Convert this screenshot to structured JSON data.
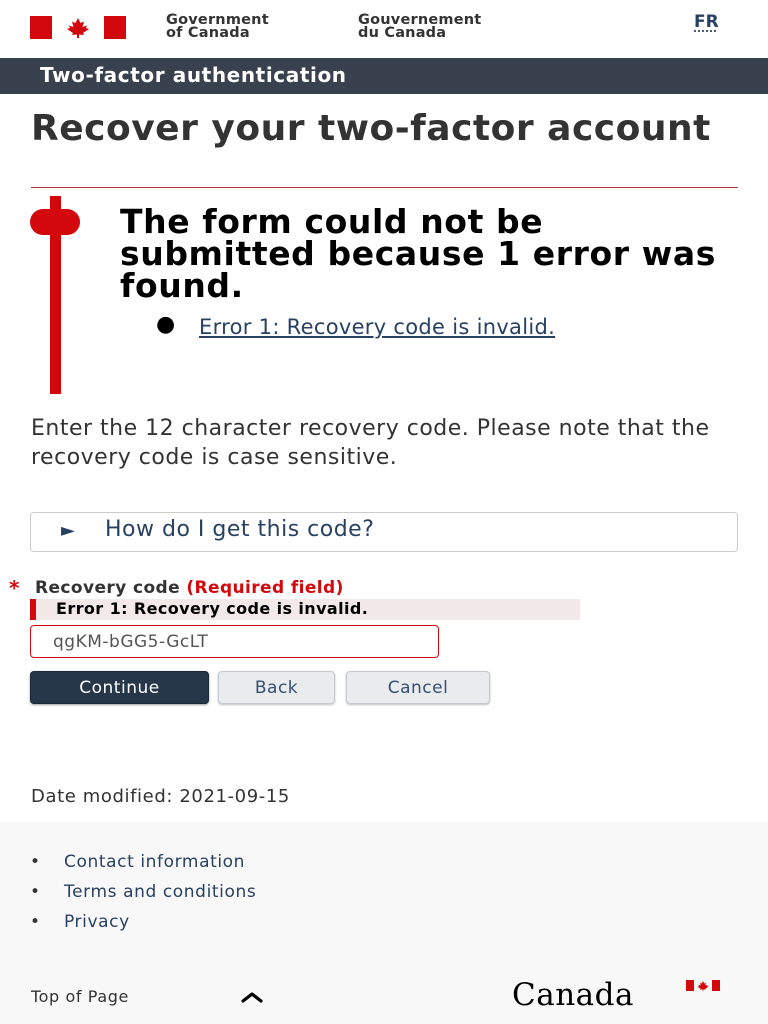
{
  "header": {
    "gov_en_line1": "Government",
    "gov_en_line2": "of Canada",
    "gov_fr_line1": "Gouvernement",
    "gov_fr_line2": "du Canada",
    "language_toggle": "FR",
    "flag_icon": "canada-flag-icon",
    "brand_red": "#d3080c"
  },
  "app_bar": {
    "title": "Two-factor authentication",
    "background": "#38414d"
  },
  "page": {
    "title": "Recover your two-factor account"
  },
  "error_summary": {
    "heading": "The form could not be submitted because 1 error was found.",
    "items": [
      {
        "text": "Error 1: Recovery code is invalid."
      }
    ]
  },
  "instructions": "Enter the 12 character recovery code. Please note that the recovery code is case sensitive.",
  "details": {
    "arrow": "►",
    "summary": "How do I get this code?"
  },
  "form": {
    "required_marker": "*",
    "label": "Recovery code",
    "required_text": "(Required field)",
    "error_message": "Error 1: Recovery code is invalid.",
    "recovery_code_value": "qgKM-bGG5-GcLT"
  },
  "buttons": {
    "continue": "Continue",
    "back": "Back",
    "cancel": "Cancel"
  },
  "date_modified": "Date modified: 2021-09-15",
  "footer": {
    "links": [
      {
        "label": "Contact information"
      },
      {
        "label": "Terms and conditions"
      },
      {
        "label": "Privacy"
      }
    ],
    "bullet": "•",
    "top_of_page": "Top of Page",
    "wordmark": "Canada",
    "link_color": "#284162"
  }
}
